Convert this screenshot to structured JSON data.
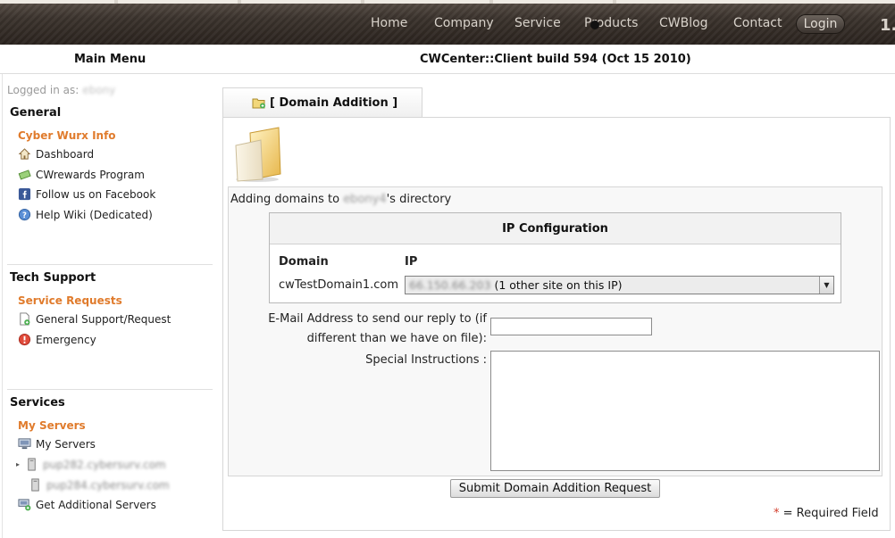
{
  "nav": {
    "items": [
      "Home",
      "Company",
      "Service",
      "Products",
      "CWBlog",
      "Contact"
    ],
    "login": "Login",
    "version": "1."
  },
  "header": {
    "main_menu": "Main Menu",
    "build": "CWCenter::Client build 594 (Oct 15 2010)"
  },
  "sidebar": {
    "logged_in_label": "Logged in as:",
    "logged_in_user": "ebony",
    "general": {
      "title": "General",
      "sub": "Cyber Wurx Info",
      "links": [
        "Dashboard",
        "CWrewards Program",
        "Follow us on Facebook",
        "Help Wiki (Dedicated)"
      ]
    },
    "tech": {
      "title": "Tech Support",
      "sub": "Service Requests",
      "links": [
        "General Support/Request",
        "Emergency"
      ]
    },
    "services": {
      "title": "Services",
      "sub": "My Servers",
      "links": [
        "My Servers",
        "pup282.cybersurv.com",
        "pup284.cybersurv.com",
        "Get Additional Servers"
      ]
    }
  },
  "tab": {
    "label": "[ Domain Addition ]"
  },
  "form": {
    "adding_prefix": "Adding domains to",
    "adding_user": "ebony4",
    "adding_suffix": "'s directory",
    "ip_config_title": "IP Configuration",
    "col_domain": "Domain",
    "col_ip": "IP",
    "domain_value": "cwTestDomain1.com",
    "ip_value_blur": "66.150.66.203",
    "ip_value_text": "(1 other site on this IP)",
    "email_label": "E-Mail Address to send our reply to (if different than we have on file):",
    "email_value": "",
    "special_label": "Special Instructions :",
    "special_value": "",
    "submit_label": "Submit Domain Addition Request",
    "required_star": "*",
    "required_text": "= Required Field"
  },
  "colors": {
    "accent_orange": "#e07b2c",
    "nav_bg": "#3b332d",
    "required_star": "#d23c2a"
  }
}
